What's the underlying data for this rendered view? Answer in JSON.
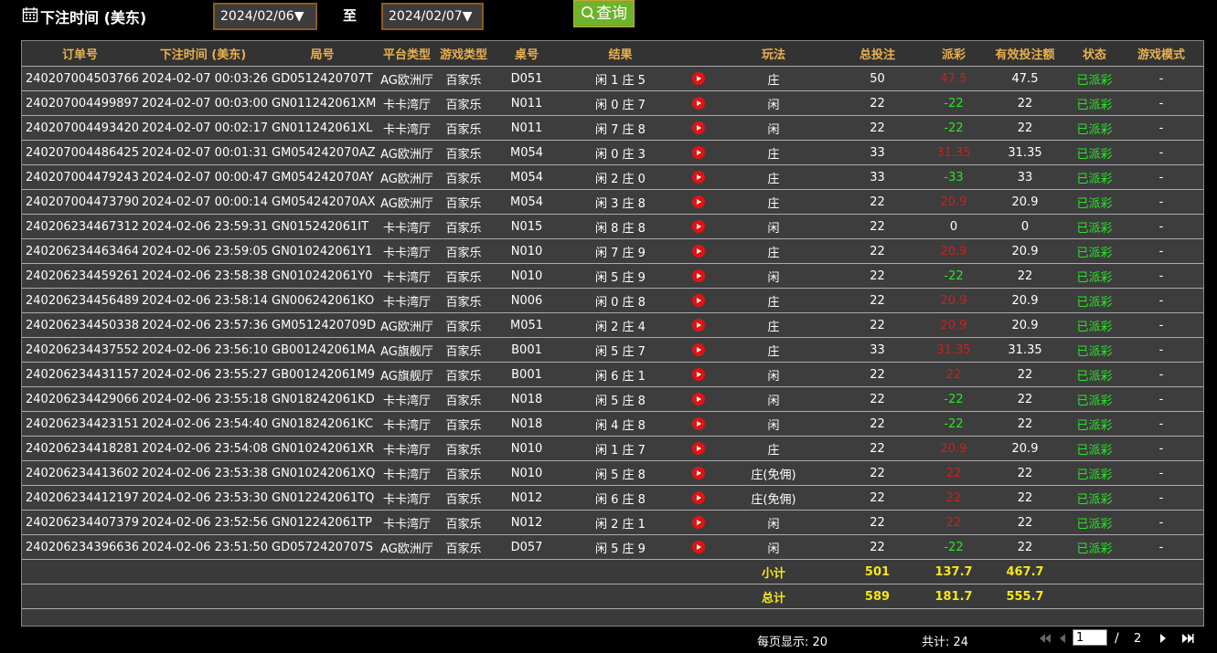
{
  "header": {
    "title": "下注时间 (美东)",
    "date_from": "2024/02/06▼",
    "to_label": "至",
    "date_to": "2024/02/07▼",
    "query_label": "查询"
  },
  "columns": [
    "订单号",
    "下注时间 (美东)",
    "局号",
    "平台类型",
    "游戏类型",
    "桌号",
    "结果",
    "",
    "玩法",
    "总投注",
    "派彩",
    "有效投注额",
    "状态",
    "游戏模式"
  ],
  "rows": [
    {
      "order": "240207004503766",
      "time": "2024-02-07 00:03:26",
      "round": "GD0512420707T",
      "platform": "AG欧洲厅",
      "game": "百家乐",
      "table": "D051",
      "result": "闲 1 庄 5",
      "play": "庄",
      "bet": "50",
      "payout": "47.5",
      "payout_color": "red",
      "valid": "47.5",
      "status": "已派彩",
      "mode": "-"
    },
    {
      "order": "240207004499897",
      "time": "2024-02-07 00:03:00",
      "round": "GN011242061XM",
      "platform": "卡卡湾厅",
      "game": "百家乐",
      "table": "N011",
      "result": "闲 0 庄 7",
      "play": "闲",
      "bet": "22",
      "payout": "-22",
      "payout_color": "green",
      "valid": "22",
      "status": "已派彩",
      "mode": "-"
    },
    {
      "order": "240207004493420",
      "time": "2024-02-07 00:02:17",
      "round": "GN011242061XL",
      "platform": "卡卡湾厅",
      "game": "百家乐",
      "table": "N011",
      "result": "闲 7 庄 8",
      "play": "闲",
      "bet": "22",
      "payout": "-22",
      "payout_color": "green",
      "valid": "22",
      "status": "已派彩",
      "mode": "-"
    },
    {
      "order": "240207004486425",
      "time": "2024-02-07 00:01:31",
      "round": "GM054242070AZ",
      "platform": "AG欧洲厅",
      "game": "百家乐",
      "table": "M054",
      "result": "闲 0 庄 3",
      "play": "庄",
      "bet": "33",
      "payout": "31.35",
      "payout_color": "red",
      "valid": "31.35",
      "status": "已派彩",
      "mode": "-"
    },
    {
      "order": "240207004479243",
      "time": "2024-02-07 00:00:47",
      "round": "GM054242070AY",
      "platform": "AG欧洲厅",
      "game": "百家乐",
      "table": "M054",
      "result": "闲 2 庄 0",
      "play": "庄",
      "bet": "33",
      "payout": "-33",
      "payout_color": "green",
      "valid": "33",
      "status": "已派彩",
      "mode": "-"
    },
    {
      "order": "240207004473790",
      "time": "2024-02-07 00:00:14",
      "round": "GM054242070AX",
      "platform": "AG欧洲厅",
      "game": "百家乐",
      "table": "M054",
      "result": "闲 3 庄 8",
      "play": "庄",
      "bet": "22",
      "payout": "20.9",
      "payout_color": "red",
      "valid": "20.9",
      "status": "已派彩",
      "mode": "-"
    },
    {
      "order": "240206234467312",
      "time": "2024-02-06 23:59:31",
      "round": "GN015242061IT",
      "platform": "卡卡湾厅",
      "game": "百家乐",
      "table": "N015",
      "result": "闲 8 庄 8",
      "play": "闲",
      "bet": "22",
      "payout": "0",
      "payout_color": "white",
      "valid": "0",
      "status": "已派彩",
      "mode": "-"
    },
    {
      "order": "240206234463464",
      "time": "2024-02-06 23:59:05",
      "round": "GN010242061Y1",
      "platform": "卡卡湾厅",
      "game": "百家乐",
      "table": "N010",
      "result": "闲 7 庄 9",
      "play": "庄",
      "bet": "22",
      "payout": "20.9",
      "payout_color": "red",
      "valid": "20.9",
      "status": "已派彩",
      "mode": "-"
    },
    {
      "order": "240206234459261",
      "time": "2024-02-06 23:58:38",
      "round": "GN010242061Y0",
      "platform": "卡卡湾厅",
      "game": "百家乐",
      "table": "N010",
      "result": "闲 5 庄 9",
      "play": "闲",
      "bet": "22",
      "payout": "-22",
      "payout_color": "green",
      "valid": "22",
      "status": "已派彩",
      "mode": "-"
    },
    {
      "order": "240206234456489",
      "time": "2024-02-06 23:58:14",
      "round": "GN006242061KO",
      "platform": "卡卡湾厅",
      "game": "百家乐",
      "table": "N006",
      "result": "闲 0 庄 8",
      "play": "庄",
      "bet": "22",
      "payout": "20.9",
      "payout_color": "red",
      "valid": "20.9",
      "status": "已派彩",
      "mode": "-"
    },
    {
      "order": "240206234450338",
      "time": "2024-02-06 23:57:36",
      "round": "GM0512420709D",
      "platform": "AG欧洲厅",
      "game": "百家乐",
      "table": "M051",
      "result": "闲 2 庄 4",
      "play": "庄",
      "bet": "22",
      "payout": "20.9",
      "payout_color": "red",
      "valid": "20.9",
      "status": "已派彩",
      "mode": "-"
    },
    {
      "order": "240206234437552",
      "time": "2024-02-06 23:56:10",
      "round": "GB001242061MA",
      "platform": "AG旗舰厅",
      "game": "百家乐",
      "table": "B001",
      "result": "闲 5 庄 7",
      "play": "庄",
      "bet": "33",
      "payout": "31.35",
      "payout_color": "red",
      "valid": "31.35",
      "status": "已派彩",
      "mode": "-"
    },
    {
      "order": "240206234431157",
      "time": "2024-02-06 23:55:27",
      "round": "GB001242061M9",
      "platform": "AG旗舰厅",
      "game": "百家乐",
      "table": "B001",
      "result": "闲 6 庄 1",
      "play": "闲",
      "bet": "22",
      "payout": "22",
      "payout_color": "red",
      "valid": "22",
      "status": "已派彩",
      "mode": "-"
    },
    {
      "order": "240206234429066",
      "time": "2024-02-06 23:55:18",
      "round": "GN018242061KD",
      "platform": "卡卡湾厅",
      "game": "百家乐",
      "table": "N018",
      "result": "闲 5 庄 8",
      "play": "闲",
      "bet": "22",
      "payout": "-22",
      "payout_color": "green",
      "valid": "22",
      "status": "已派彩",
      "mode": "-"
    },
    {
      "order": "240206234423151",
      "time": "2024-02-06 23:54:40",
      "round": "GN018242061KC",
      "platform": "卡卡湾厅",
      "game": "百家乐",
      "table": "N018",
      "result": "闲 4 庄 8",
      "play": "闲",
      "bet": "22",
      "payout": "-22",
      "payout_color": "green",
      "valid": "22",
      "status": "已派彩",
      "mode": "-"
    },
    {
      "order": "240206234418281",
      "time": "2024-02-06 23:54:08",
      "round": "GN010242061XR",
      "platform": "卡卡湾厅",
      "game": "百家乐",
      "table": "N010",
      "result": "闲 1 庄 7",
      "play": "庄",
      "bet": "22",
      "payout": "20.9",
      "payout_color": "red",
      "valid": "20.9",
      "status": "已派彩",
      "mode": "-"
    },
    {
      "order": "240206234413602",
      "time": "2024-02-06 23:53:38",
      "round": "GN010242061XQ",
      "platform": "卡卡湾厅",
      "game": "百家乐",
      "table": "N010",
      "result": "闲 5 庄 8",
      "play": "庄(免佣)",
      "bet": "22",
      "payout": "22",
      "payout_color": "red",
      "valid": "22",
      "status": "已派彩",
      "mode": "-"
    },
    {
      "order": "240206234412197",
      "time": "2024-02-06 23:53:30",
      "round": "GN012242061TQ",
      "platform": "卡卡湾厅",
      "game": "百家乐",
      "table": "N012",
      "result": "闲 6 庄 8",
      "play": "庄(免佣)",
      "bet": "22",
      "payout": "22",
      "payout_color": "red",
      "valid": "22",
      "status": "已派彩",
      "mode": "-"
    },
    {
      "order": "240206234407379",
      "time": "2024-02-06 23:52:56",
      "round": "GN012242061TP",
      "platform": "卡卡湾厅",
      "game": "百家乐",
      "table": "N012",
      "result": "闲 2 庄 1",
      "play": "闲",
      "bet": "22",
      "payout": "22",
      "payout_color": "red",
      "valid": "22",
      "status": "已派彩",
      "mode": "-"
    },
    {
      "order": "240206234396636",
      "time": "2024-02-06 23:51:50",
      "round": "GD0572420707S",
      "platform": "AG欧洲厅",
      "game": "百家乐",
      "table": "D057",
      "result": "闲 5 庄 9",
      "play": "闲",
      "bet": "22",
      "payout": "-22",
      "payout_color": "green",
      "valid": "22",
      "status": "已派彩",
      "mode": "-"
    }
  ],
  "subtotal": {
    "label": "小计",
    "bet": "501",
    "payout": "137.7",
    "valid": "467.7"
  },
  "total": {
    "label": "总计",
    "bet": "589",
    "payout": "181.7",
    "valid": "555.7"
  },
  "footer": {
    "per_page": "每页显示: 20",
    "total_count": "共计: 24",
    "current_page": "1",
    "separator": "/",
    "page_count": "2"
  },
  "colors": {
    "accent_header": "#e8b04f",
    "win": "#d21e1e",
    "loss": "#27e627",
    "sum": "#f4e61d",
    "query_button": "#6fb32a"
  }
}
